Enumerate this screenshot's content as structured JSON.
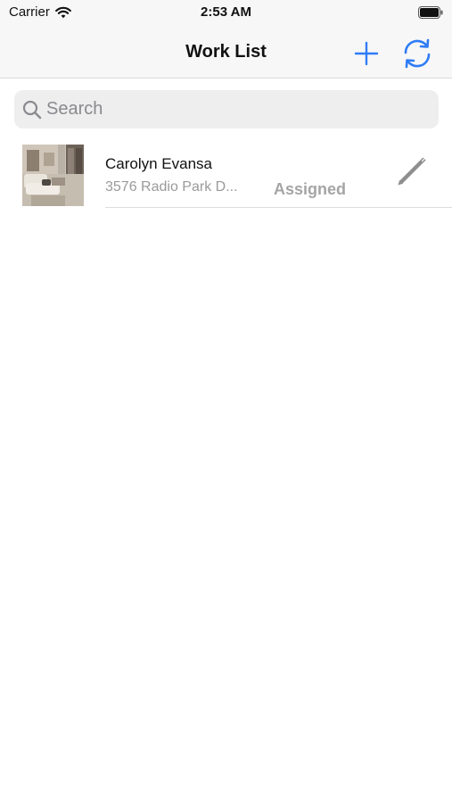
{
  "status_bar": {
    "carrier": "Carrier",
    "time": "2:53 AM"
  },
  "nav": {
    "title": "Work List",
    "add_icon": "plus-icon",
    "refresh_icon": "refresh-icon"
  },
  "search": {
    "placeholder": "Search",
    "value": ""
  },
  "work_items": [
    {
      "name": "Carolyn Evansa",
      "address": "3576 Radio Park D...",
      "status": "Assigned",
      "thumbnail": "room-photo",
      "edit_icon": "pencil-icon"
    }
  ],
  "colors": {
    "accent": "#2f7cf6",
    "status_gray": "#a5a5a5",
    "secondary_text": "#9a9a9a"
  }
}
